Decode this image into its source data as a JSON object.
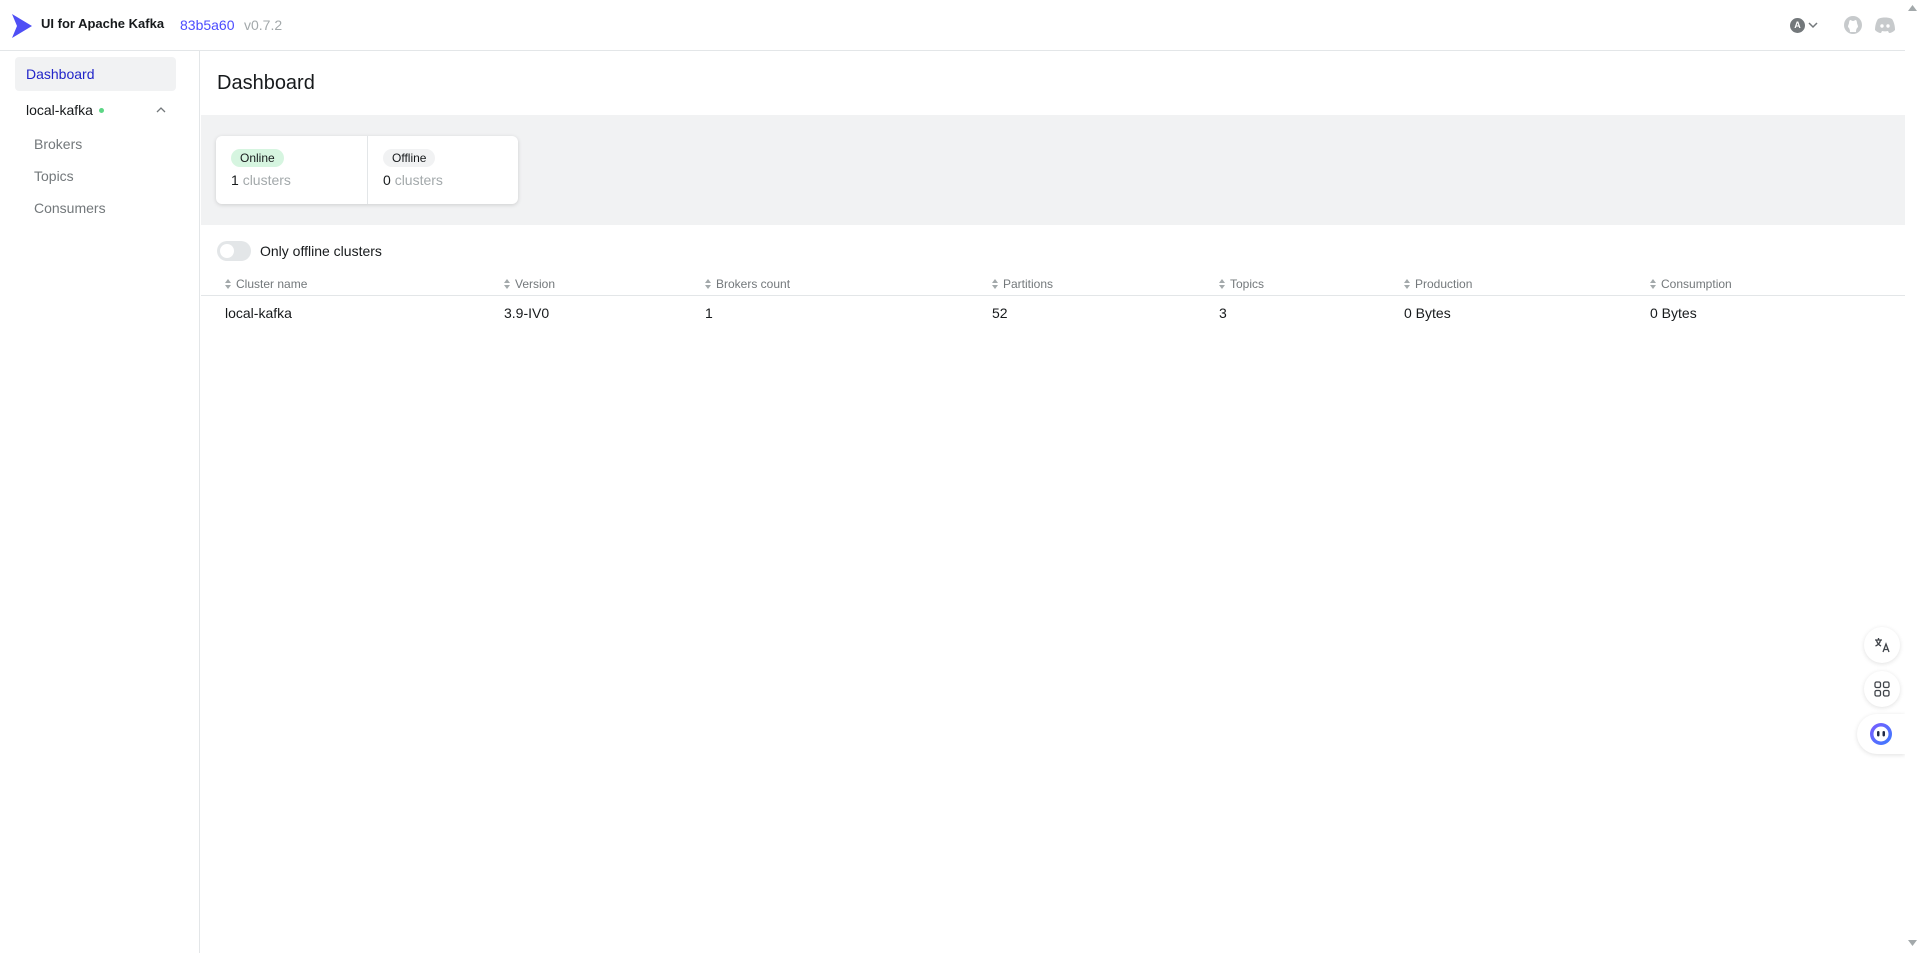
{
  "navbar": {
    "app_title": "UI for Apache Kafka",
    "commit": "83b5a60",
    "version": "v0.7.2",
    "user_initial": "A"
  },
  "sidebar": {
    "dashboard_label": "Dashboard",
    "cluster": {
      "name": "local-kafka",
      "status": "online",
      "items": [
        {
          "label": "Brokers"
        },
        {
          "label": "Topics"
        },
        {
          "label": "Consumers"
        }
      ]
    }
  },
  "main": {
    "title": "Dashboard",
    "metrics": {
      "online": {
        "badge": "Online",
        "value": "1",
        "unit": "clusters"
      },
      "offline": {
        "badge": "Offline",
        "value": "0",
        "unit": "clusters"
      }
    },
    "toggle_label": "Only offline clusters",
    "table": {
      "headers": [
        "Cluster name",
        "Version",
        "Brokers count",
        "Partitions",
        "Topics",
        "Production",
        "Consumption"
      ],
      "rows": [
        [
          "local-kafka",
          "3.9-IV0",
          "1",
          "52",
          "3",
          "0 Bytes",
          "0 Bytes"
        ]
      ]
    }
  },
  "colors": {
    "accent": "#4c4cff",
    "online_badge": "#d6f5e0",
    "status_dot": "#5cd685"
  },
  "icons": [
    "kafka-logo-icon",
    "chevron-down-icon",
    "github-icon",
    "discord-icon",
    "chevron-up-icon",
    "sort-icon",
    "translate-icon",
    "apps-grid-icon",
    "assistant-icon"
  ]
}
